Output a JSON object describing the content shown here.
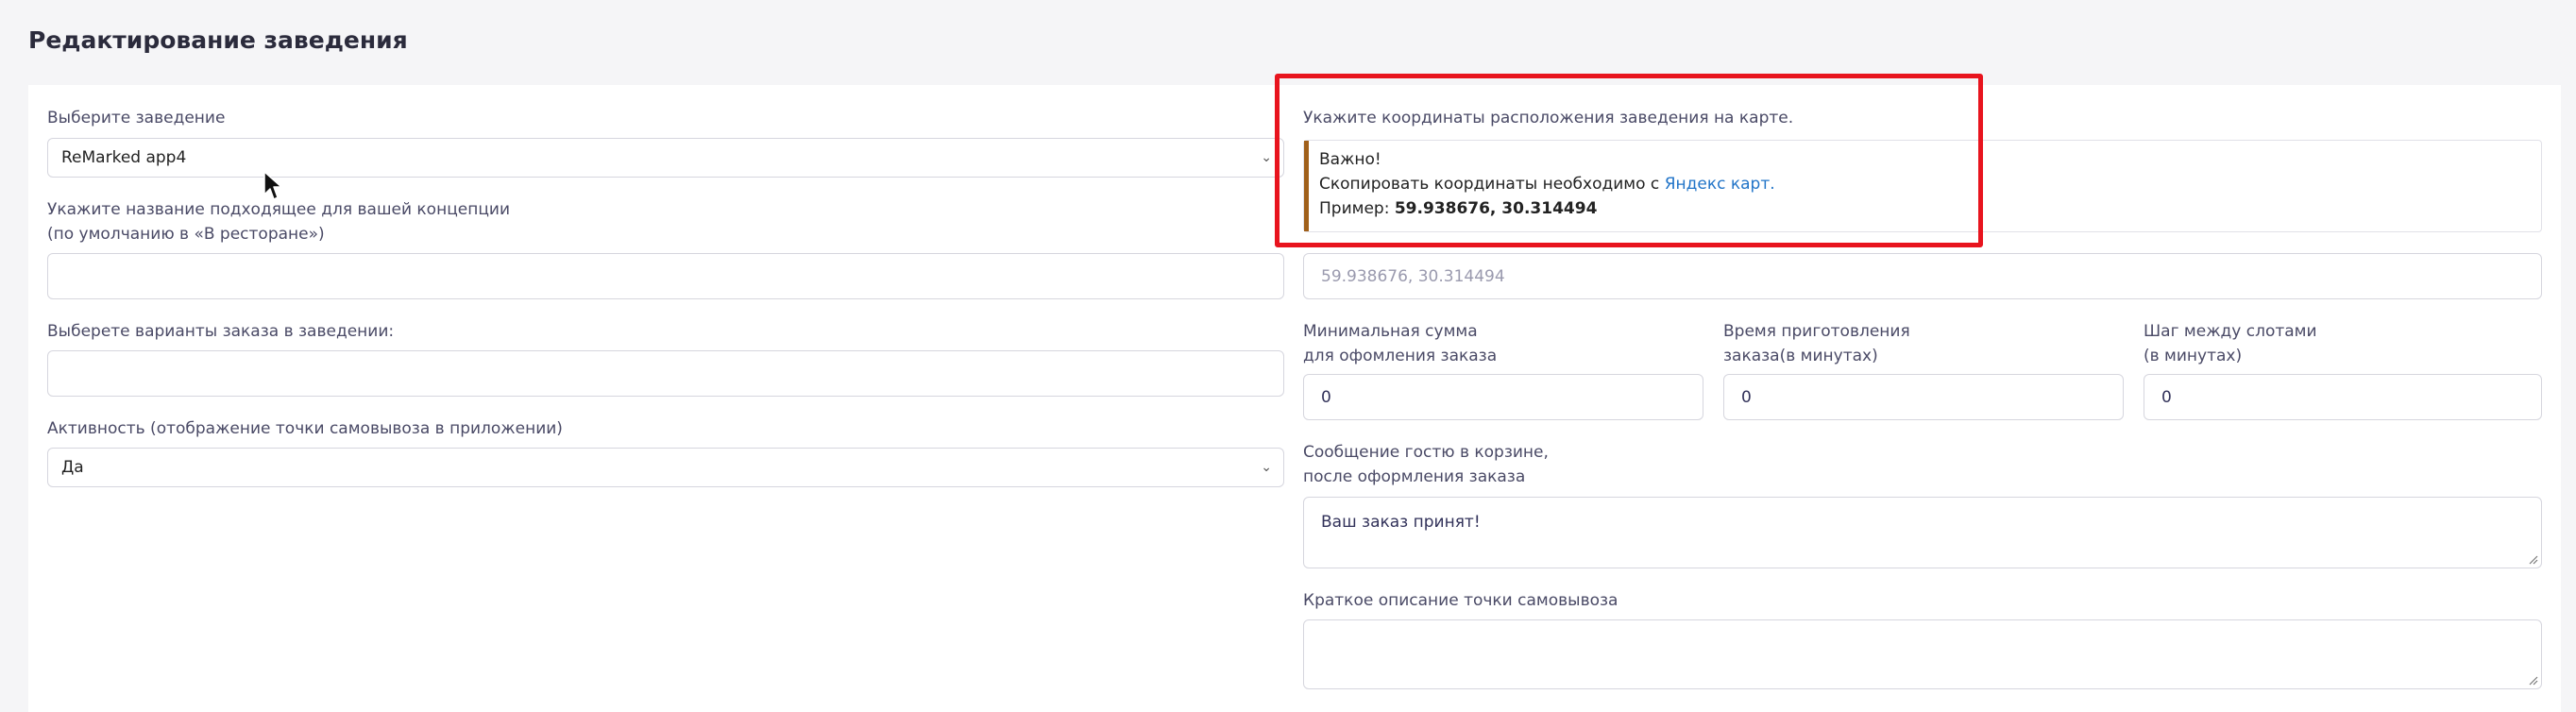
{
  "page": {
    "title": "Редактирование заведения"
  },
  "left": {
    "venue_label": "Выберите заведение",
    "venue_value": "ReMarked app4",
    "concept_label_1": "Укажите название подходящее для вашей концепции",
    "concept_label_2": "(по умолчанию в «В ресторане»)",
    "concept_value": "",
    "order_options_label": "Выберете варианты заказа в заведении:",
    "order_options_value": "",
    "activity_label": "Активность (отображение точки самовывоза в приложении)",
    "activity_value": "Да"
  },
  "right": {
    "coords_label": "Укажите координаты расположения заведения на карте.",
    "note_important": "Важно!",
    "note_copy_text": "Скопировать координаты необходимо с",
    "note_link": "Яндекс карт.",
    "note_example_label": "Пример:",
    "note_example_value": "59.938676, 30.314494",
    "coords_placeholder": "59.938676, 30.314494",
    "min_sum_label_1": "Минимальная сумма",
    "min_sum_label_2": "для офомления заказа",
    "min_sum_value": "0",
    "prep_time_label_1": "Время приготовления",
    "prep_time_label_2": "заказа(в минутах)",
    "prep_time_value": "0",
    "slot_step_label_1": "Шаг между слотами",
    "slot_step_label_2": "(в минутах)",
    "slot_step_value": "0",
    "message_label_1": "Сообщение гостю в корзине,",
    "message_label_2": "после оформления заказа",
    "message_value": "Ваш заказ принят!",
    "description_label": "Краткое описание точки самовывоза",
    "description_value": ""
  },
  "colors": {
    "highlight": "#e8141e",
    "link": "#2174c8",
    "note_bar": "#a0601a"
  },
  "icons": {
    "select_arrow": "chevron-down-icon",
    "cursor": "mouse-pointer-icon"
  }
}
